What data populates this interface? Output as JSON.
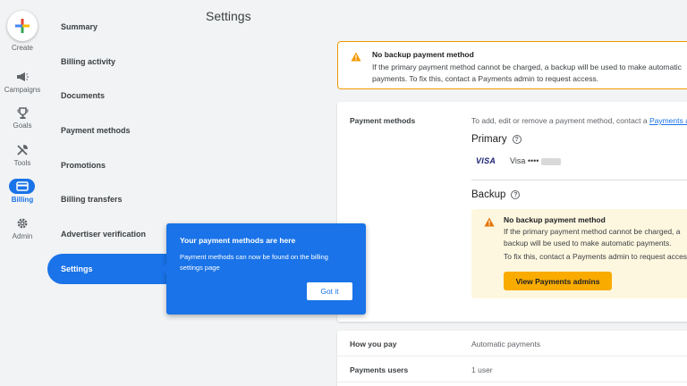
{
  "rail": {
    "create": "Create",
    "campaigns": "Campaigns",
    "goals": "Goals",
    "tools": "Tools",
    "billing": "Billing",
    "admin": "Admin"
  },
  "nav": {
    "summary": "Summary",
    "billing_activity": "Billing activity",
    "documents": "Documents",
    "payment_methods": "Payment methods",
    "promotions": "Promotions",
    "billing_transfers": "Billing transfers",
    "advertiser_verification": "Advertiser verification",
    "settings": "Settings"
  },
  "page_title": "Settings",
  "banner": {
    "title": "No backup payment method",
    "text": "If the primary payment method cannot be charged, a backup will be used to make automatic payments. To fix this, contact a Payments admin to request access."
  },
  "payment_card": {
    "label": "Payment methods",
    "hint": "To add, edit or remove a payment method, contact a",
    "hint_link": "Payments admin",
    "primary_heading": "Primary",
    "visa_logo": "VISA",
    "visa_text": "Visa ••••",
    "backup_heading": "Backup",
    "backup_warning": {
      "title": "No backup payment method",
      "text": "If the primary payment method cannot be charged, a backup will be used to make automatic payments.",
      "text2": "To fix this, contact a Payments admin to request access.",
      "button": "View Payments admins"
    }
  },
  "info_rows": [
    {
      "key": "How you pay",
      "value": "Automatic payments"
    },
    {
      "key": "Payments users",
      "value": "1 user"
    }
  ],
  "tooltip": {
    "title": "Your payment methods are here",
    "text": "Payment methods can now be found on the billing settings page",
    "button": "Got it"
  },
  "colors": {
    "accent": "#1a73e8",
    "warning": "#f29900",
    "warning_bg": "#fef7e0",
    "button_yellow": "#f9ab00"
  }
}
